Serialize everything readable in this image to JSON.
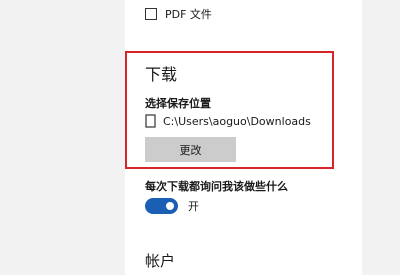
{
  "pdf": {
    "label": "PDF 文件",
    "checked": false
  },
  "download": {
    "title": "下载",
    "save_location_heading": "选择保存位置",
    "path": "C:\\Users\\aoguo\\Downloads",
    "change_button": "更改"
  },
  "ask_each_download": {
    "label": "每次下载都询问我该做些什么",
    "state_label": "开",
    "on": true
  },
  "account": {
    "title": "帐户"
  },
  "colors": {
    "accent": "#1a5fb4",
    "highlight": "#d7262a",
    "button_bg": "#cccccc",
    "sidebar_bg": "#f2f2f2"
  },
  "icons": {
    "pdf_checkbox": "checkbox-unchecked-icon",
    "path_icon": "document-icon",
    "toggle": "toggle-on-icon"
  }
}
